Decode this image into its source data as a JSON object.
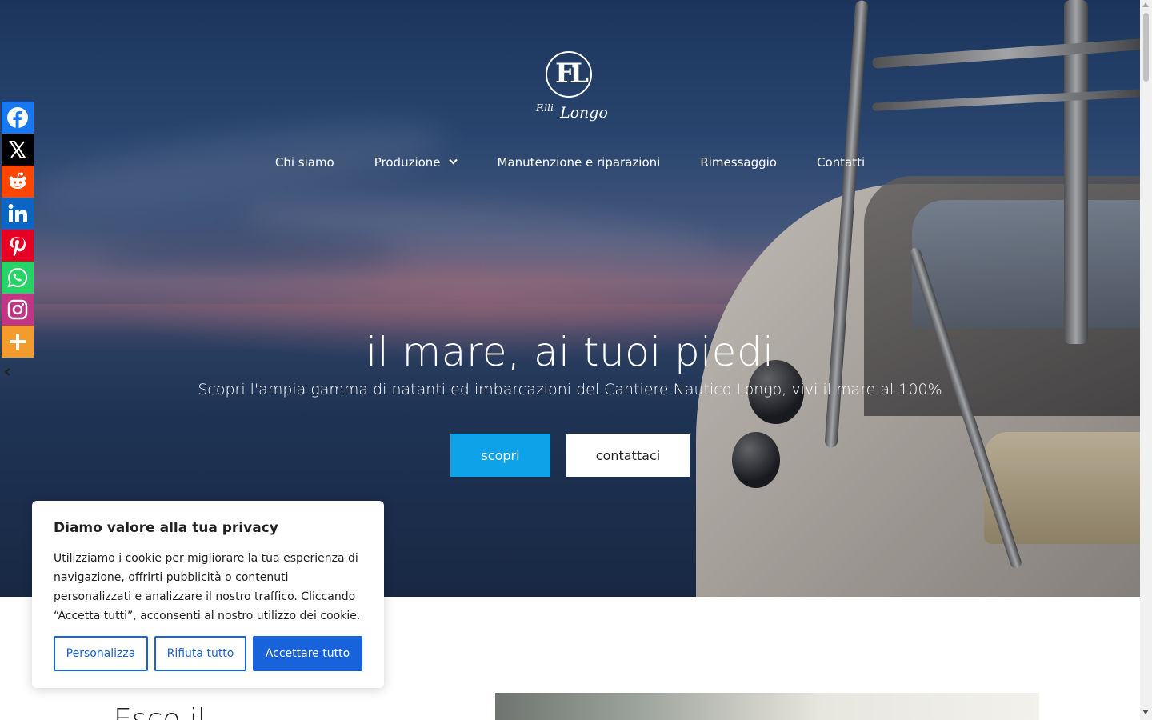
{
  "logo": {
    "prefix": "F.lli",
    "name": "Longo",
    "mark": "FL"
  },
  "nav": {
    "items": [
      {
        "label": "Chi siamo"
      },
      {
        "label": "Produzione",
        "has_dropdown": true
      },
      {
        "label": "Manutenzione e riparazioni"
      },
      {
        "label": "Rimessaggio"
      },
      {
        "label": "Contatti"
      }
    ]
  },
  "hero": {
    "title": "il mare, ai tuoi piedi",
    "subtitle": "Scopri l'ampia gamma di natanti ed imbarcazioni del Cantiere Nautico Longo, vivi il mare al 100%",
    "primary_button": "scopri",
    "secondary_button": "contattaci"
  },
  "share_bar": {
    "items": [
      {
        "name": "facebook",
        "color": "#1877f2"
      },
      {
        "name": "x",
        "color": "#000000"
      },
      {
        "name": "reddit",
        "color": "#ff4500"
      },
      {
        "name": "linkedin",
        "color": "#0a66c2"
      },
      {
        "name": "pinterest",
        "color": "#e60023"
      },
      {
        "name": "whatsapp",
        "color": "#25d366"
      },
      {
        "name": "instagram",
        "color": "#c13584"
      },
      {
        "name": "more",
        "color": "#f39c2c"
      }
    ]
  },
  "section": {
    "heading_partial": "Esce il"
  },
  "cookie_banner": {
    "title": "Diamo valore alla tua privacy",
    "text": "Utilizziamo i cookie per migliorare la tua esperienza di navigazione, offrirti pubblicità o contenuti personalizzati e analizzare il nostro traffico. Cliccando “Accetta tutti”, acconsenti al nostro utilizzo dei cookie.",
    "customize": "Personalizza",
    "reject": "Rifiuta tutto",
    "accept": "Accettare tutto",
    "accent_color": "#1863dc"
  },
  "colors": {
    "primary_button": "#0ea3e9"
  }
}
